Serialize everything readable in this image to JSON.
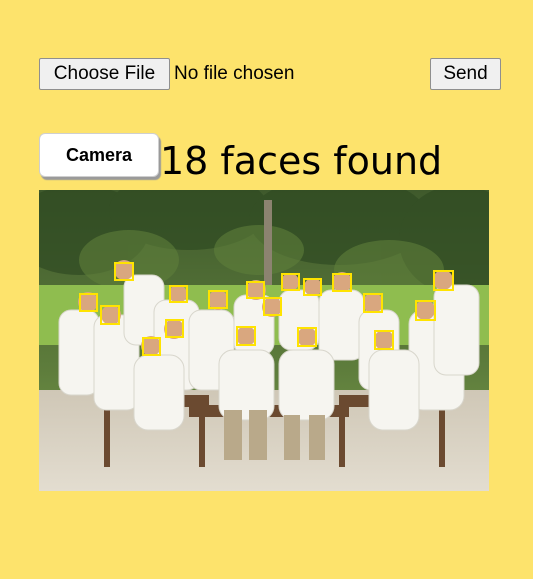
{
  "file_input": {
    "button_label": "Choose File",
    "status_text": "No file chosen"
  },
  "send_button": {
    "label": "Send"
  },
  "camera_button": {
    "label": "Camera"
  },
  "result": {
    "faces_found_text": "18 faces found"
  },
  "photo": {
    "description_hidden": "",
    "face_box_color": "#ffe300",
    "face_count": 18
  }
}
